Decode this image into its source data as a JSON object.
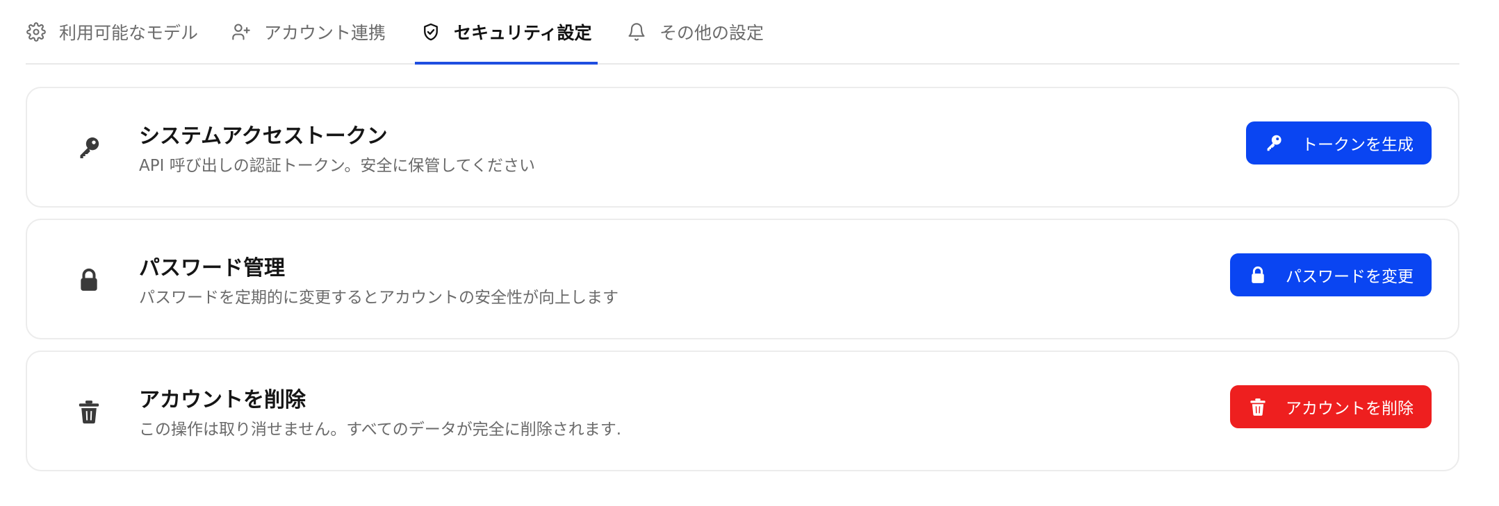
{
  "tabs": [
    {
      "label": "利用可能なモデル",
      "icon": "gear-icon",
      "active": false
    },
    {
      "label": "アカウント連携",
      "icon": "user-plus-icon",
      "active": false
    },
    {
      "label": "セキュリティ設定",
      "icon": "shield-check-icon",
      "active": true
    },
    {
      "label": "その他の設定",
      "icon": "bell-icon",
      "active": false
    }
  ],
  "cards": [
    {
      "icon": "key-icon",
      "title": "システムアクセストークン",
      "description": "API 呼び出しの認証トークン。安全に保管してください",
      "button": {
        "label": "トークンを生成",
        "icon": "key-icon",
        "color": "#0a45f2"
      }
    },
    {
      "icon": "lock-icon",
      "title": "パスワード管理",
      "description": "パスワードを定期的に変更するとアカウントの安全性が向上します",
      "button": {
        "label": "パスワードを変更",
        "icon": "lock-icon",
        "color": "#0a45f2"
      }
    },
    {
      "icon": "trash-icon",
      "title": "アカウントを削除",
      "description": "この操作は取り消せません。すべてのデータが完全に削除されます.",
      "button": {
        "label": "アカウントを削除",
        "icon": "trash-icon",
        "color": "#ee1f1f"
      }
    }
  ],
  "colors": {
    "accent": "#1f4ee0",
    "primary_button": "#0a45f2",
    "danger_button": "#ee1f1f"
  }
}
